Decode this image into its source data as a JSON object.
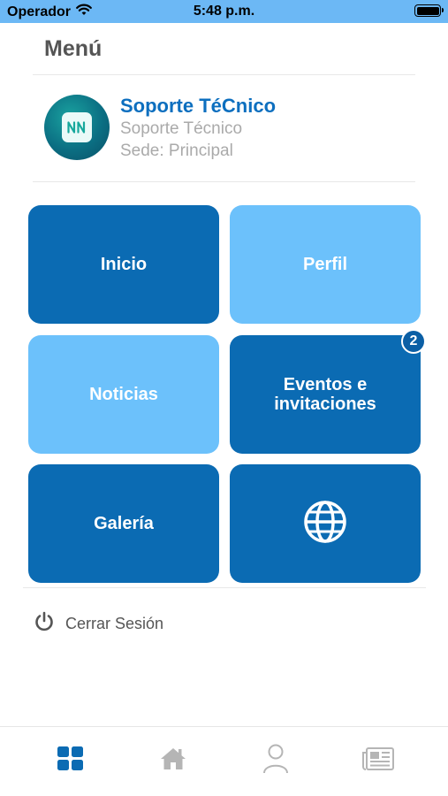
{
  "status_bar": {
    "carrier": "Operador",
    "time": "5:48 p.m."
  },
  "header": {
    "title": "Menú"
  },
  "profile": {
    "name": "Soporte TéCnico",
    "role": "Soporte Técnico",
    "sede": "Sede: Principal",
    "avatar_icon": "nn-logo-icon"
  },
  "tiles": [
    {
      "label": "Inicio",
      "style": "dark"
    },
    {
      "label": "Perfil",
      "style": "light"
    },
    {
      "label": "Noticias",
      "style": "light"
    },
    {
      "label": "Eventos e invitaciones",
      "style": "dark",
      "badge": "2"
    },
    {
      "label": "Galería",
      "style": "dark"
    },
    {
      "icon": "globe-icon",
      "style": "dark"
    }
  ],
  "logout": {
    "label": "Cerrar Sesión",
    "icon": "power-icon"
  },
  "tabbar": {
    "items": [
      {
        "icon": "grid-icon",
        "active": true
      },
      {
        "icon": "home-icon",
        "active": false
      },
      {
        "icon": "user-icon",
        "active": false
      },
      {
        "icon": "newspaper-icon",
        "active": false
      }
    ]
  },
  "colors": {
    "status_bar": "#6cb8f5",
    "tile_dark": "#0b6bb3",
    "tile_light": "#6cc1fb",
    "name_blue": "#0d6fbf",
    "tab_active": "#0b6bb3",
    "tab_inactive": "#b5b5b5"
  }
}
